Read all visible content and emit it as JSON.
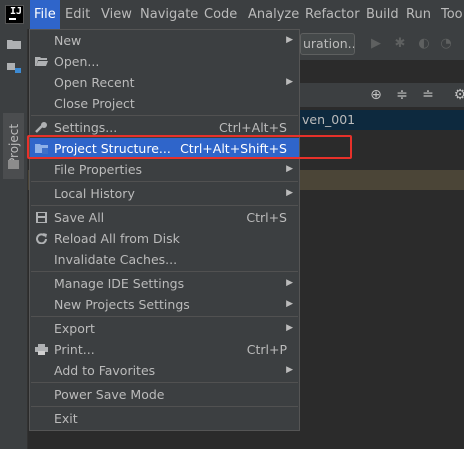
{
  "menubar": {
    "items": [
      "File",
      "Edit",
      "View",
      "Navigate",
      "Code",
      "Analyze",
      "Refactor",
      "Build",
      "Run",
      "Too"
    ]
  },
  "toolbar": {
    "config_label": "uration..."
  },
  "side_panel": {
    "project_label": "Project",
    "tree_text": "ven_001"
  },
  "file_menu": {
    "items": [
      {
        "label": "New",
        "shortcut": "",
        "submenu": true
      },
      {
        "label": "Open...",
        "shortcut": "",
        "submenu": false,
        "icon": "folder-open-icon"
      },
      {
        "label": "Open Recent",
        "shortcut": "",
        "submenu": true
      },
      {
        "label": "Close Project",
        "shortcut": "",
        "submenu": false
      },
      {
        "label": "Settings...",
        "shortcut": "Ctrl+Alt+S",
        "submenu": false,
        "icon": "wrench-icon"
      },
      {
        "label": "Project Structure...",
        "shortcut": "Ctrl+Alt+Shift+S",
        "submenu": false,
        "icon": "project-structure-icon",
        "selected": true
      },
      {
        "label": "File Properties",
        "shortcut": "",
        "submenu": true
      },
      {
        "label": "Local History",
        "shortcut": "",
        "submenu": true
      },
      {
        "label": "Save All",
        "shortcut": "Ctrl+S",
        "submenu": false,
        "icon": "save-icon"
      },
      {
        "label": "Reload All from Disk",
        "shortcut": "",
        "submenu": false,
        "icon": "reload-icon"
      },
      {
        "label": "Invalidate Caches...",
        "shortcut": "",
        "submenu": false
      },
      {
        "label": "Manage IDE Settings",
        "shortcut": "",
        "submenu": true
      },
      {
        "label": "New Projects Settings",
        "shortcut": "",
        "submenu": true
      },
      {
        "label": "Export",
        "shortcut": "",
        "submenu": true
      },
      {
        "label": "Print...",
        "shortcut": "Ctrl+P",
        "submenu": false,
        "icon": "print-icon"
      },
      {
        "label": "Add to Favorites",
        "shortcut": "",
        "submenu": true
      },
      {
        "label": "Power Save Mode",
        "shortcut": "",
        "submenu": false
      },
      {
        "label": "Exit",
        "shortcut": "",
        "submenu": false
      }
    ]
  },
  "colors": {
    "accent": "#2f65ca",
    "menu_bg": "#3c3f41",
    "annotation": "#e8312a"
  }
}
